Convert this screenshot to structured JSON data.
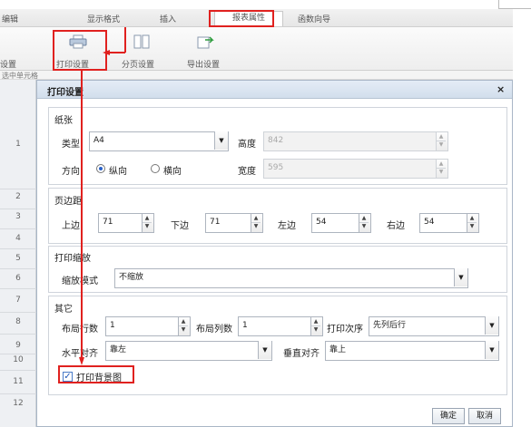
{
  "ribbon": {
    "tabs": [
      "编辑",
      "显示格式",
      "插入",
      "报表属性",
      "函数向导"
    ],
    "active_tab": "报表属性",
    "buttons": {
      "left_cut": "设置",
      "print_setup": "打印设置",
      "paging_setup": "分页设置",
      "export_setup": "导出设置"
    },
    "formula_hint": "选中单元格"
  },
  "rows": [
    "1",
    "2",
    "3",
    "4",
    "5",
    "6",
    "7",
    "8",
    "9",
    "10",
    "11",
    "12"
  ],
  "dialog": {
    "title": "打印设置",
    "close": "×",
    "paper": {
      "section": "纸张",
      "type_label": "类型",
      "type_value": "A4",
      "height_label": "高度",
      "height_value": "842",
      "orientation_label": "方向",
      "portrait": "纵向",
      "landscape": "横向",
      "width_label": "宽度",
      "width_value": "595"
    },
    "margins": {
      "section": "页边距",
      "top_label": "上边",
      "top_value": "71",
      "bottom_label": "下边",
      "bottom_value": "71",
      "left_label": "左边",
      "left_value": "54",
      "right_label": "右边",
      "right_value": "54"
    },
    "scale": {
      "section": "打印缩放",
      "mode_label": "缩放模式",
      "mode_value": "不缩放"
    },
    "other": {
      "section": "其它",
      "layout_rows_label": "布局行数",
      "layout_rows_value": "1",
      "layout_cols_label": "布局列数",
      "layout_cols_value": "1",
      "order_label": "打印次序",
      "order_value": "先列后行",
      "halign_label": "水平对齐",
      "halign_value": "靠左",
      "valign_label": "垂直对齐",
      "valign_value": "靠上",
      "print_bg_label": "打印背景图",
      "print_bg_checked": true
    },
    "ok": "确定",
    "cancel": "取消"
  },
  "colors": {
    "annotation": "#e0211f",
    "accent": "#2a62c9"
  }
}
